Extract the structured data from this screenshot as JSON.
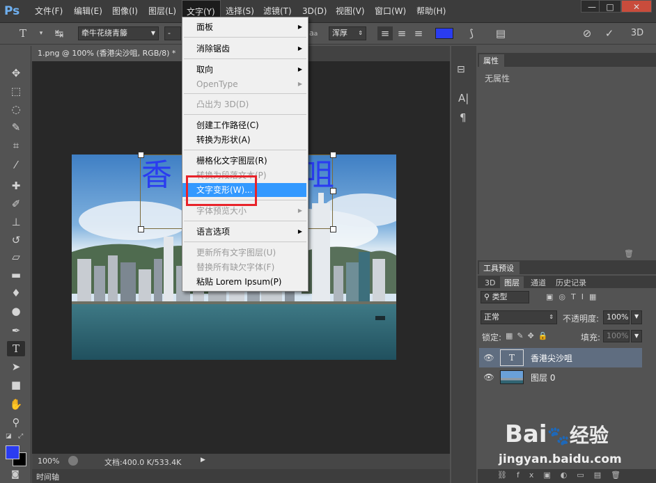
{
  "app": {
    "logo": "Ps"
  },
  "menubar": {
    "items": [
      "文件(F)",
      "编辑(E)",
      "图像(I)",
      "图层(L)",
      "文字(Y)",
      "选择(S)",
      "滤镜(T)",
      "3D(D)",
      "视图(V)",
      "窗口(W)",
      "帮助(H)"
    ],
    "window_controls": [
      "—",
      "□",
      "✕"
    ]
  },
  "options": {
    "font_family": "牵牛花绕青籐",
    "font_style": "-",
    "antialias": "浑厚",
    "aa_label": "a",
    "text_color": "#2a3cf0"
  },
  "document": {
    "tab_title": "1.png @ 100% (香港尖沙咀, RGB/8) *",
    "overlay_text": "香港尖沙咀",
    "overlay_visible_left": "香",
    "overlay_visible_right": "咀"
  },
  "text_menu": {
    "items": [
      {
        "label": "面板",
        "submenu": true,
        "disabled": false
      },
      {
        "label": "消除锯齿",
        "submenu": true,
        "disabled": false
      },
      {
        "label": "取向",
        "submenu": true,
        "disabled": false
      },
      {
        "label": "OpenType",
        "submenu": true,
        "disabled": true
      },
      {
        "label": "凸出为 3D(D)",
        "submenu": false,
        "disabled": true
      },
      {
        "label": "创建工作路径(C)",
        "submenu": false,
        "disabled": false
      },
      {
        "label": "转换为形状(A)",
        "submenu": false,
        "disabled": false
      },
      {
        "label": "栅格化文字图层(R)",
        "submenu": false,
        "disabled": false
      },
      {
        "label": "转换为段落文本(P)",
        "submenu": false,
        "disabled": true
      },
      {
        "label": "文字变形(W)...",
        "submenu": false,
        "disabled": false,
        "highlighted": true
      },
      {
        "label": "字体预览大小",
        "submenu": true,
        "disabled": true
      },
      {
        "label": "语言选项",
        "submenu": true,
        "disabled": false
      },
      {
        "label": "更新所有文字图层(U)",
        "submenu": false,
        "disabled": true
      },
      {
        "label": "替换所有缺欠字体(F)",
        "submenu": false,
        "disabled": true
      },
      {
        "label": "粘贴 Lorem Ipsum(P)",
        "submenu": false,
        "disabled": false
      }
    ]
  },
  "status": {
    "zoom": "100%",
    "doc_info": "文档:400.0 K/533.4K"
  },
  "timeline": {
    "label": "时间轴"
  },
  "properties_panel": {
    "tab": "属性",
    "content": "无属性"
  },
  "tool_presets": {
    "tab": "工具预设"
  },
  "layers_panel": {
    "tabs": [
      "3D",
      "图层",
      "通道",
      "历史记录"
    ],
    "filter_label": "类型",
    "blend_mode": "正常",
    "opacity_label": "不透明度:",
    "opacity_value": "100%",
    "lock_label": "锁定:",
    "fill_label": "填充:",
    "fill_value": "100%",
    "layers": [
      {
        "name": "香港尖沙咀",
        "type": "text",
        "thumb": "T",
        "selected": true
      },
      {
        "name": "图层 0",
        "type": "image",
        "selected": false
      }
    ]
  },
  "watermark": {
    "brand": "Bai",
    "brand_cn": "经验",
    "url": "jingyan.baidu.com"
  },
  "colors": {
    "accent_highlight": "#3399ff",
    "red_box": "#e8232a",
    "foreground": "#2a3cf0",
    "background": "#000000"
  }
}
